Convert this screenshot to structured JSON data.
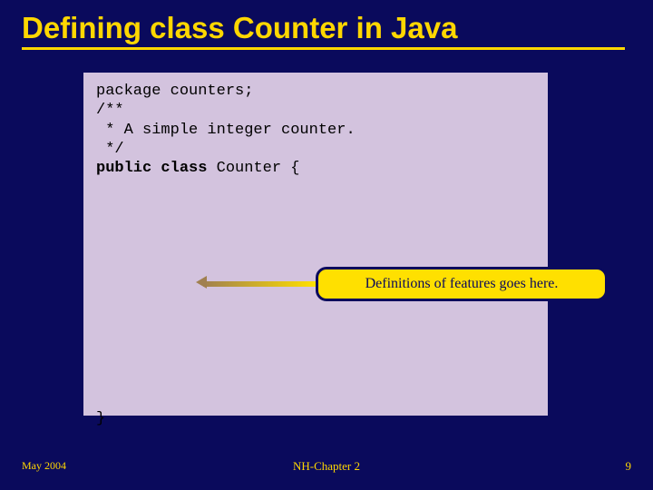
{
  "title": "Defining class Counter in Java",
  "code": {
    "line1": "package counters;",
    "line2": "/**",
    "line3": " * A simple integer counter.",
    "line4": " */",
    "kw_public": "public",
    "kw_class": "class",
    "class_decl_rest": " Counter {",
    "close_brace": "}"
  },
  "callout": "Definitions of features goes here.",
  "footer": {
    "left": "May 2004",
    "center": "NH-Chapter 2",
    "right": "9"
  }
}
